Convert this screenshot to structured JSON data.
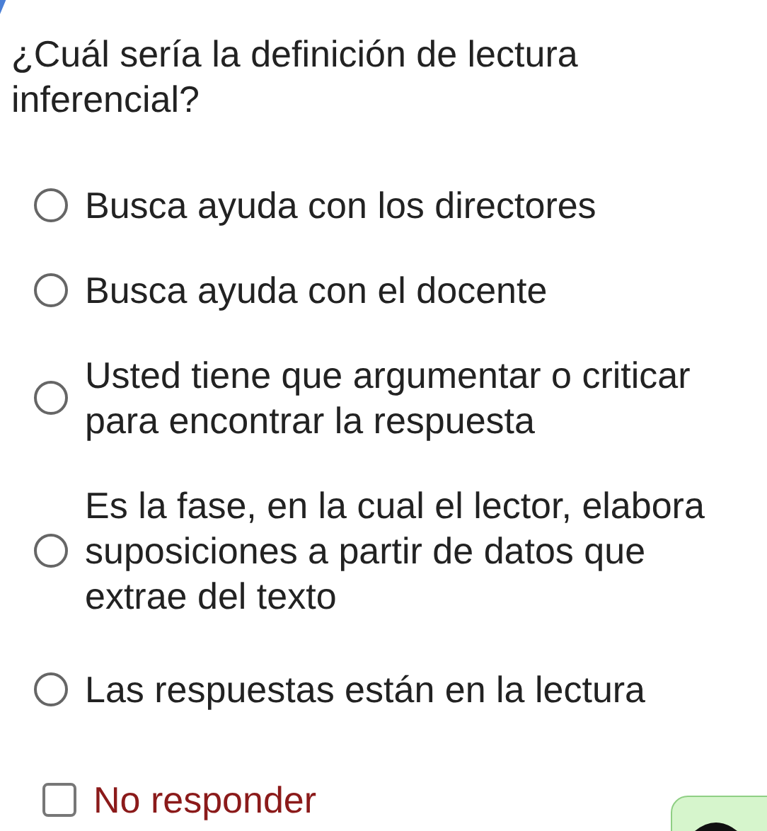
{
  "question": "¿Cuál sería la definición de lectura inferencial?",
  "options": [
    {
      "kind": "radio",
      "label": "Busca ayuda con los directores",
      "selected": false
    },
    {
      "kind": "radio",
      "label": "Busca ayuda con el docente",
      "selected": false
    },
    {
      "kind": "radio",
      "label": "Usted tiene que argumentar o criticar para encontrar la respuesta",
      "selected": false
    },
    {
      "kind": "radio",
      "label": "Es la fase, en la cual el lector, elabora suposiciones a partir de datos que extrae del texto",
      "selected": false
    },
    {
      "kind": "radio",
      "label": "Las respuestas están en la lectura",
      "selected": false
    },
    {
      "kind": "checkbox",
      "label": "No responder",
      "checked": false
    }
  ]
}
